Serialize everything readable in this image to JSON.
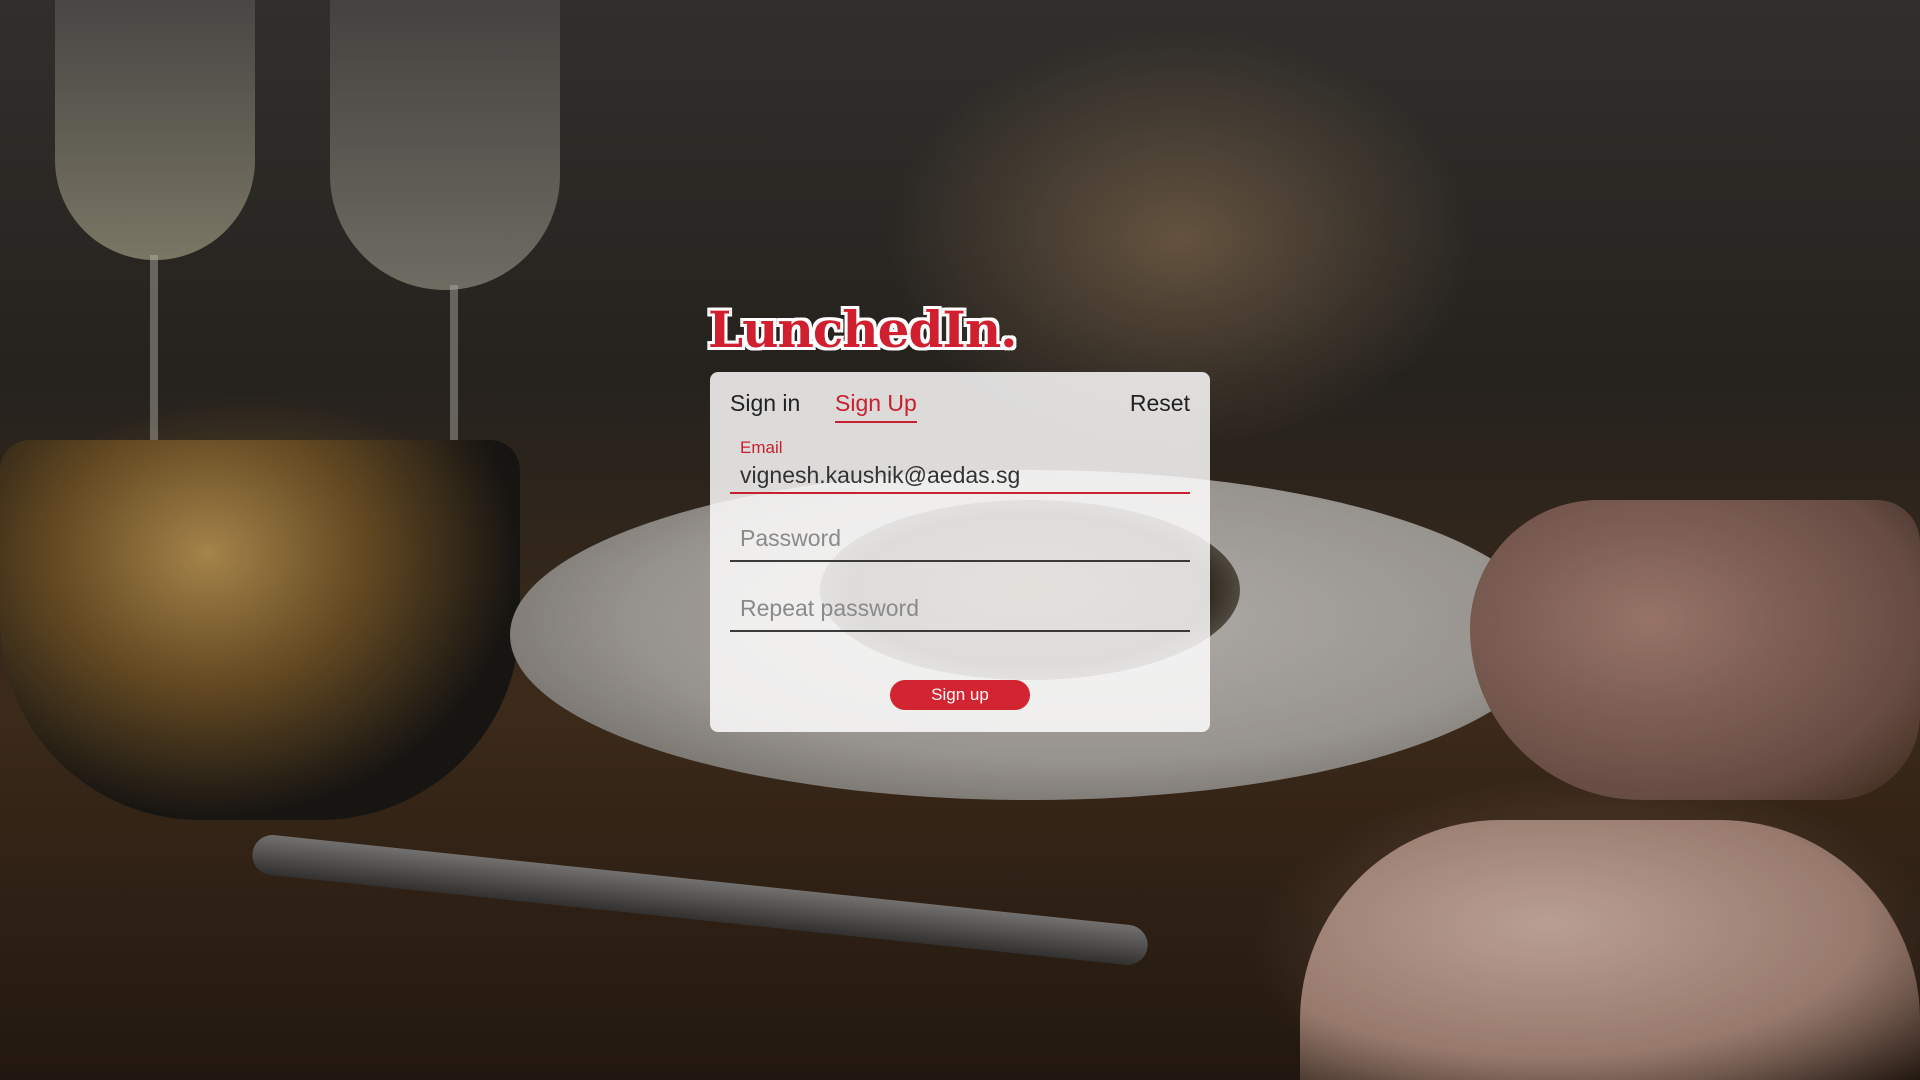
{
  "app": {
    "logo_text": "LunchedIn."
  },
  "tabs": {
    "sign_in": "Sign in",
    "sign_up": "Sign Up",
    "reset": "Reset",
    "active": "Sign Up"
  },
  "form": {
    "email_label": "Email",
    "email_value": "vignesh.kaushik@aedas.sg",
    "password_placeholder": "Password",
    "repeat_password_placeholder": "Repeat password",
    "submit_label": "Sign up"
  },
  "colors": {
    "accent": "#d0202f",
    "card_background": "rgba(255,255,255,0.84)"
  }
}
